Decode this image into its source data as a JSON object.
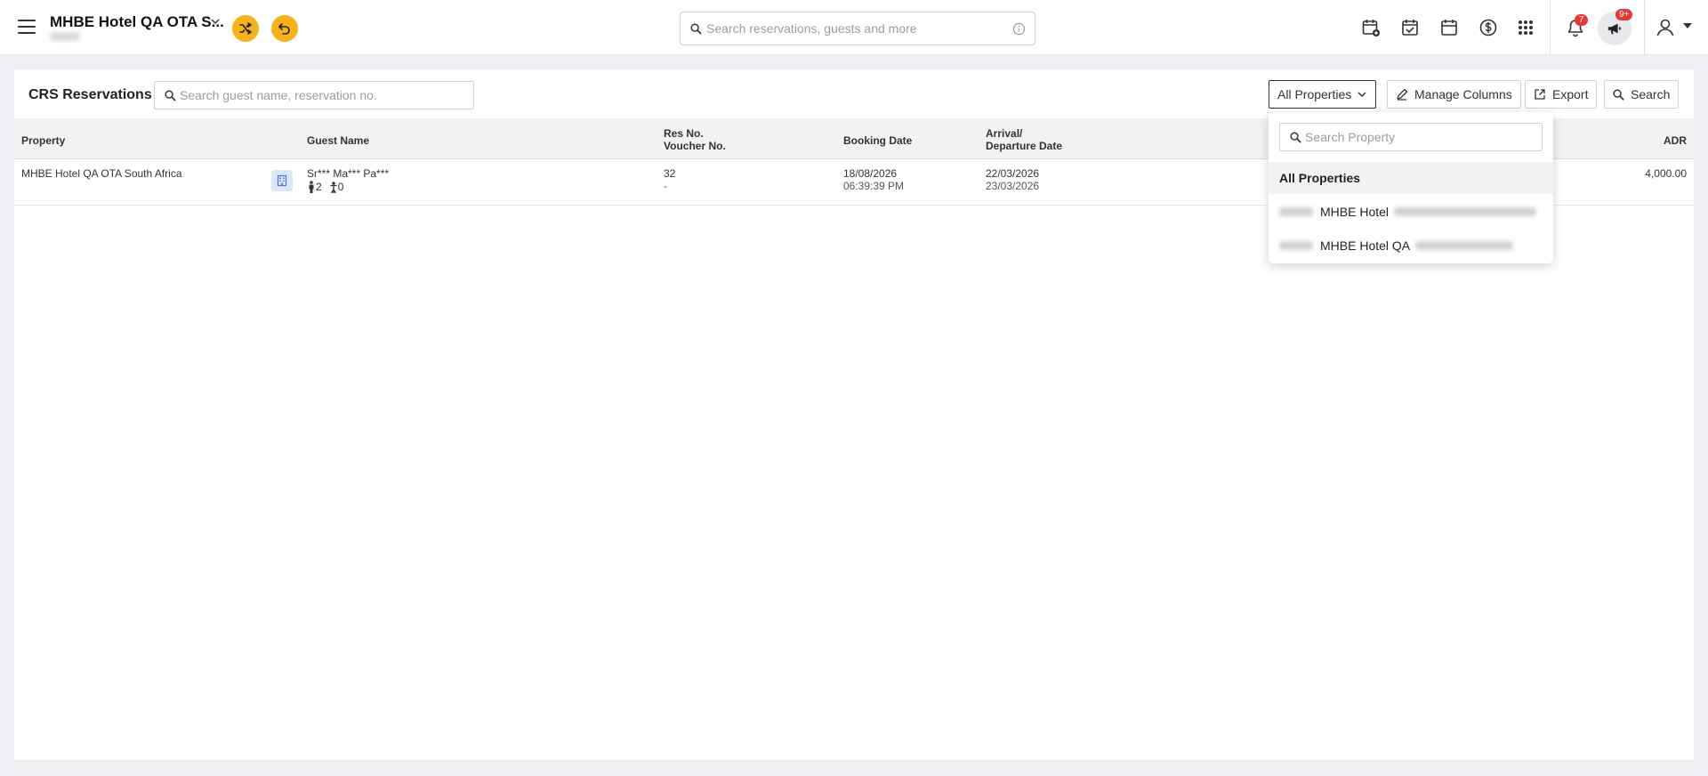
{
  "header": {
    "hotel_name": "MHBE Hotel QA OTA S...",
    "search_placeholder": "Search reservations, guests and more",
    "notifications_badge": "7",
    "announcements_badge": "9+"
  },
  "page": {
    "title": "CRS Reservations",
    "search_placeholder": "Search guest name, reservation no.",
    "properties_button": "All Properties",
    "manage_columns_button": "Manage Columns",
    "export_button": "Export",
    "search_button": "Search"
  },
  "table": {
    "headers": {
      "property": "Property",
      "guest_name": "Guest Name",
      "res_no": "Res No.",
      "voucher_no": "Voucher No.",
      "booking_date": "Booking Date",
      "arrival": "Arrival/",
      "departure": "Departure Date",
      "adr": "ADR"
    },
    "rows": [
      {
        "property": "MHBE Hotel QA OTA South Africa",
        "guest_name": "Sr*** Ma*** Pa***",
        "adults": "2",
        "children": "0",
        "res_no": "32",
        "voucher_no": "-",
        "booking_date": "18/08/2026",
        "booking_time": "06:39:39 PM",
        "arrival_date": "22/03/2026",
        "departure_date": "23/03/2026",
        "adr": "4,000.00"
      }
    ]
  },
  "property_dropdown": {
    "search_placeholder": "Search Property",
    "options": [
      {
        "label": "All Properties"
      },
      {
        "label": "MHBE Hotel"
      },
      {
        "label": "MHBE Hotel QA"
      }
    ]
  },
  "colors": {
    "accent": "#f6b21b",
    "badge": "#e53935",
    "property_icon_bg": "#dbe6f7"
  }
}
